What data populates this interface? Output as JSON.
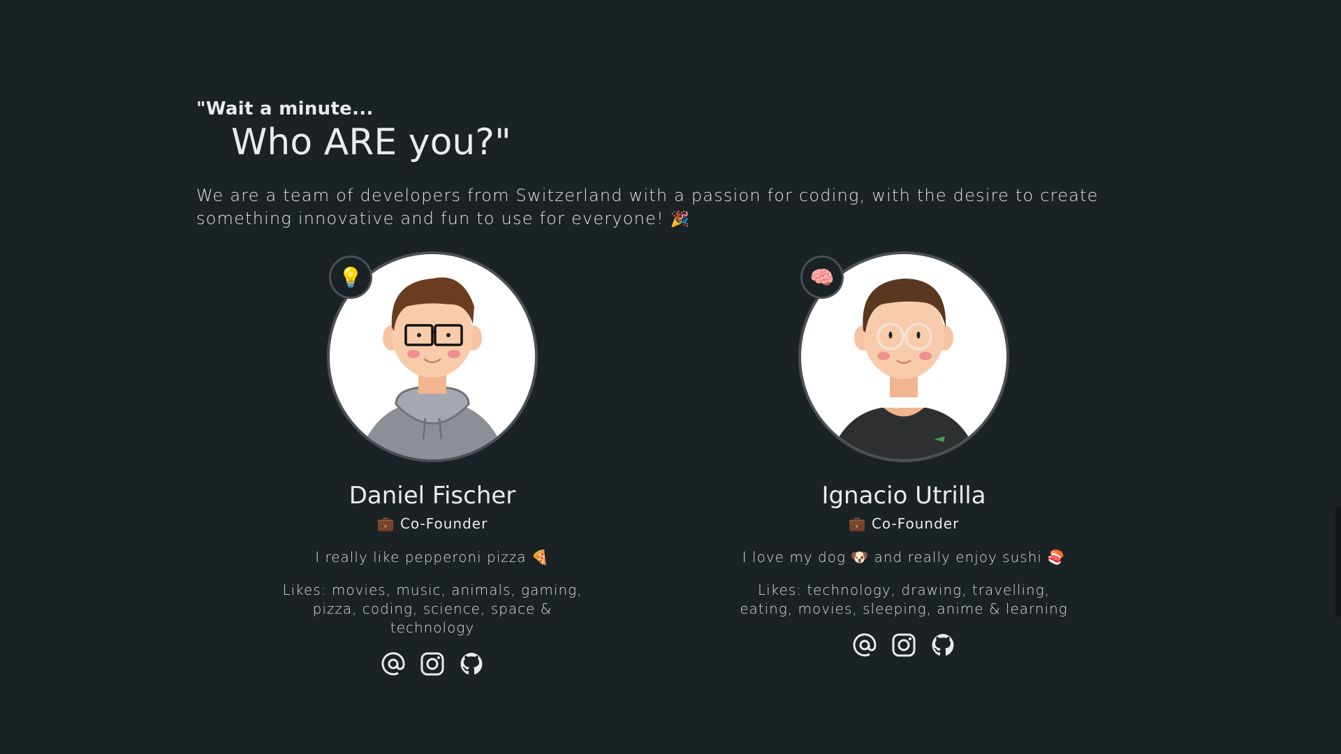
{
  "intro": {
    "eyebrow": "\"Wait a minute...",
    "headline": "Who ARE you?\"",
    "description": "We are a team of developers from Switzerland with a passion for coding, with the desire to create something innovative and fun to use for everyone!",
    "description_emoji": "🎉"
  },
  "members": [
    {
      "badge_emoji": "💡",
      "badge_icon": "lightbulb-icon",
      "name": "Daniel Fischer",
      "role_emoji": "💼",
      "role": "Co-Founder",
      "quote": "I really like pepperoni pizza",
      "quote_emoji": "🍕",
      "likes_line1": "Likes: movies, music, animals, gaming,",
      "likes_line2": "pizza, coding, science, space & technology",
      "socials": [
        "email-icon",
        "instagram-icon",
        "github-icon"
      ],
      "shirt_color": "#8c8f96"
    },
    {
      "badge_emoji": "🧠",
      "badge_icon": "brain-icon",
      "name": "Ignacio Utrilla",
      "role_emoji": "💼",
      "role": "Co-Founder",
      "quote_part1": "I love my dog",
      "quote_emoji1": "🐶",
      "quote_part2": "and really enjoy sushi",
      "quote_emoji2": "🍣",
      "likes_line1": "Likes: technology, drawing, travelling,",
      "likes_line2": "eating, movies, sleeping, anime & learning",
      "socials": [
        "email-icon",
        "instagram-icon",
        "github-icon"
      ],
      "shirt_color": "#2e2f31"
    }
  ],
  "colors": {
    "background": "#1b2226",
    "text": "#e9ecee",
    "avatar_ring": "#4a4f53"
  }
}
